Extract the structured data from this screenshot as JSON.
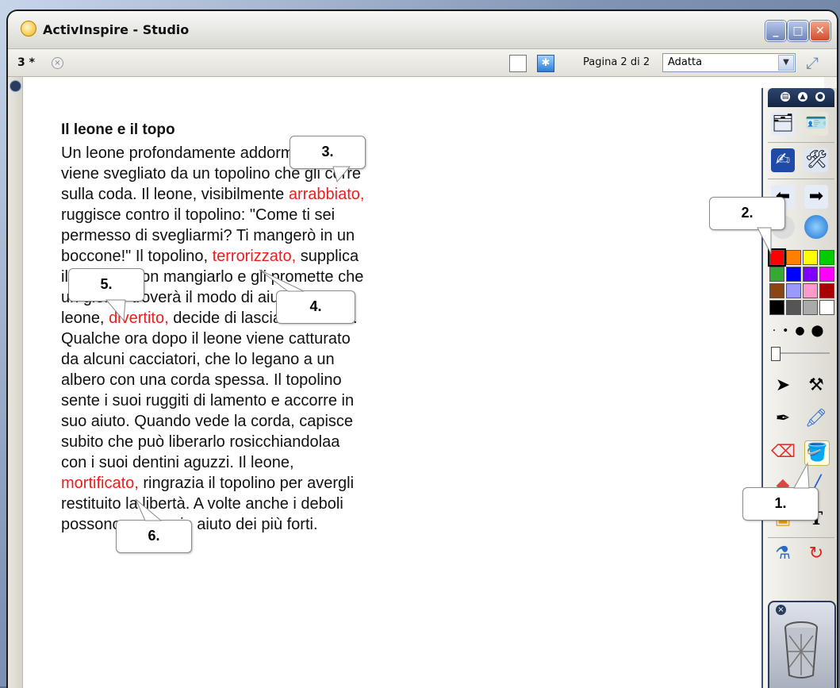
{
  "window": {
    "title": "ActivInspire - Studio",
    "controls": [
      "minimize",
      "maximize",
      "close"
    ]
  },
  "toolbar": {
    "tab_label": "3 *",
    "page_indicator": "Pagina 2 di 2",
    "zoom_value": "Adatta"
  },
  "document": {
    "title": "Il leone e il topo",
    "lines": [
      [
        {
          "t": "Un leone profondamente addormentato"
        }
      ],
      [
        {
          "t": "viene svegliato da un topolino che gli corre"
        }
      ],
      [
        {
          "t": "sulla coda. Il leone, visibilmente "
        },
        {
          "t": "arrabbiato,",
          "red": true
        }
      ],
      [
        {
          "t": "ruggisce contro il topolino: \"Come ti sei"
        }
      ],
      [
        {
          "t": "permesso di svegliarmi? Ti mangerò in un"
        }
      ],
      [
        {
          "t": "boccone!\" Il topolino, "
        },
        {
          "t": "terrorizzato,",
          "red": true
        },
        {
          "t": " supplica"
        }
      ],
      [
        {
          "t": "il leone di non mangiarlo e gli promette che"
        }
      ],
      [
        {
          "t": "un giorno troverà il modo di aiutarlo. Il"
        }
      ],
      [
        {
          "t": "leone, "
        },
        {
          "t": "divertito,",
          "red": true
        },
        {
          "t": " decide di lasciarlo andare."
        }
      ],
      [
        {
          "t": "Qualche ora dopo il leone viene catturato"
        }
      ],
      [
        {
          "t": "da alcuni cacciatori, che lo legano a un"
        }
      ],
      [
        {
          "t": "albero con una corda spessa. Il topolino"
        }
      ],
      [
        {
          "t": "sente i suoi ruggiti di lamento e accorre in"
        }
      ],
      [
        {
          "t": "suo aiuto. Quando vede la corda, capisce"
        }
      ],
      [
        {
          "t": "subito che può liberarlo rosicchiandolaa"
        }
      ],
      [
        {
          "t": "con i suoi dentini aguzzi. Il leone,"
        }
      ],
      [
        {
          "t": "mortificato,",
          "red": true
        },
        {
          "t": " ringrazia il topolino per avergli"
        }
      ],
      [
        {
          "t": "restituito la libertà. A volte anche i deboli"
        }
      ],
      [
        {
          "t": "possono correre in aiuto dei più forti."
        }
      ]
    ],
    "highlight_color": "#ee1c1c"
  },
  "callouts": [
    "1.",
    "2.",
    "3.",
    "4.",
    "5.",
    "6."
  ],
  "palette": {
    "colors": [
      "#ff0000",
      "#ff8000",
      "#ffff00",
      "#00cc00",
      "#33aa33",
      "#0000ff",
      "#8000ff",
      "#ff00ff",
      "#8b4513",
      "#9999ff",
      "#ff99cc",
      "#aa0000",
      "#000000",
      "#555555",
      "#aaaaaa",
      "#ffffff"
    ],
    "selected_color": "#ff0000"
  }
}
